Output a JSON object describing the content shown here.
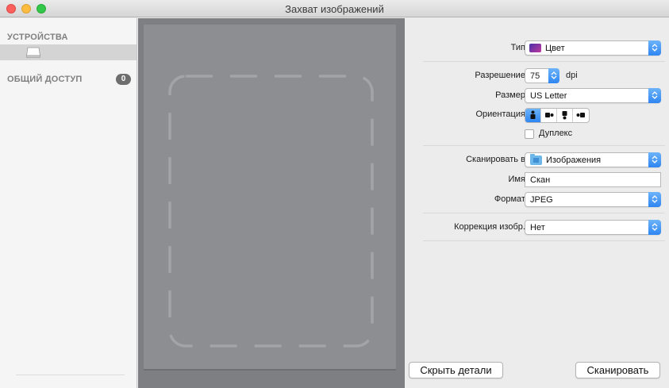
{
  "window": {
    "title": "Захват изображений"
  },
  "sidebar": {
    "devices_header": "УСТРОЙСТВА",
    "shared_header": "ОБЩИЙ ДОСТУП",
    "shared_count": "0"
  },
  "details": {
    "type_label": "Тип:",
    "type_value": "Цвет",
    "resolution_label": "Разрешение:",
    "resolution_value": "75",
    "resolution_unit": "dpi",
    "size_label": "Размер:",
    "size_value": "US Letter",
    "orientation_label": "Ориентация:",
    "duplex_label": "Дуплекс",
    "duplex_checked": false,
    "scan_to_label": "Сканировать в:",
    "scan_to_value": "Изображения",
    "name_label": "Имя:",
    "name_value": "Скан",
    "format_label": "Формат:",
    "format_value": "JPEG",
    "correction_label": "Коррекция изобр.:",
    "correction_value": "Нет"
  },
  "buttons": {
    "hide_details": "Скрыть детали",
    "scan": "Сканировать"
  },
  "colors": {
    "accent": "#2f86f2",
    "preview_bg": "#7e7f82"
  }
}
